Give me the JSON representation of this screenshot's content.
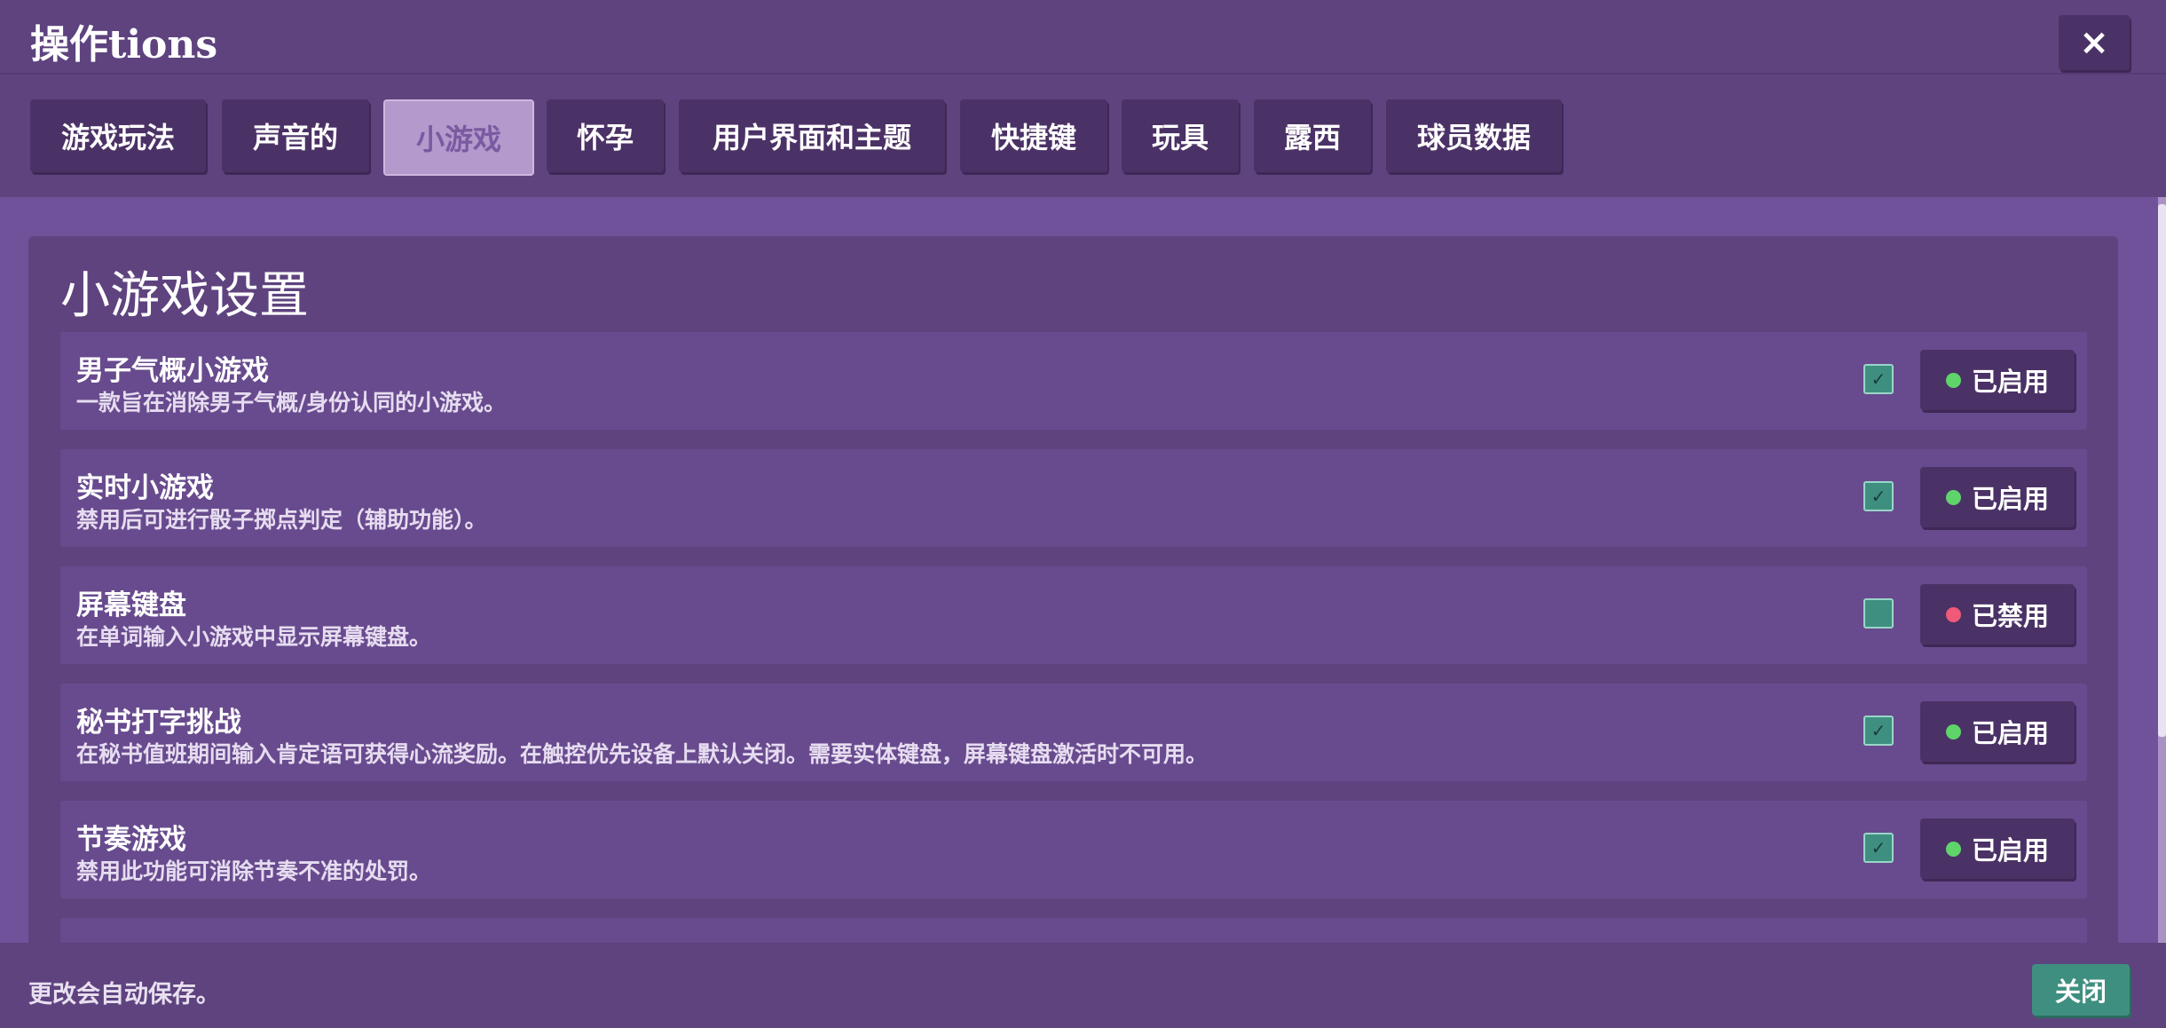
{
  "window": {
    "title": "操作tions",
    "close_icon": "×"
  },
  "tabs": [
    {
      "label": "游戏玩法",
      "active": false
    },
    {
      "label": "声音的",
      "active": false
    },
    {
      "label": "小游戏",
      "active": true
    },
    {
      "label": "怀孕",
      "active": false
    },
    {
      "label": "用户界面和主题",
      "active": false
    },
    {
      "label": "快捷键",
      "active": false
    },
    {
      "label": "玩具",
      "active": false
    },
    {
      "label": "露西",
      "active": false
    },
    {
      "label": "球员数据",
      "active": false
    }
  ],
  "section": {
    "title": "小游戏设置",
    "settings": [
      {
        "title": "男子气概小游戏",
        "description": "一款旨在消除男子气概/身份认同的小游戏。",
        "checked": true,
        "status": "已启用"
      },
      {
        "title": "实时小游戏",
        "description": "禁用后可进行骰子掷点判定（辅助功能）。",
        "checked": true,
        "status": "已启用"
      },
      {
        "title": "屏幕键盘",
        "description": "在单词输入小游戏中显示屏幕键盘。",
        "checked": false,
        "status": "已禁用"
      },
      {
        "title": "秘书打字挑战",
        "description": "在秘书值班期间输入肯定语可获得心流奖励。在触控优先设备上默认关闭。需要实体键盘，屏幕键盘激活时不可用。",
        "checked": true,
        "status": "已启用"
      },
      {
        "title": "节奏游戏",
        "description": "禁用此功能可消除节奏不准的处罚。",
        "checked": true,
        "status": "已启用"
      }
    ]
  },
  "footer": {
    "note": "更改会自动保存。",
    "close_label": "关闭"
  },
  "colors": {
    "enabled_dot": "#5fd46b",
    "disabled_dot": "#ef5a78",
    "checkbox_green": "#3f8f80"
  },
  "icons": {
    "checkmark": "✓"
  }
}
